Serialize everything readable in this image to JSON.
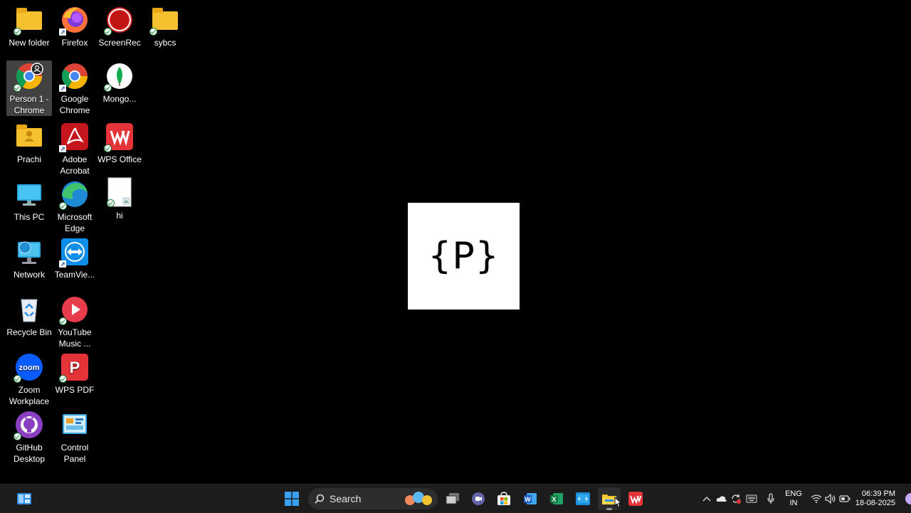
{
  "desktop": {
    "icons": {
      "new_folder": "New folder",
      "firefox": "Firefox",
      "screenrec": "ScreenRec",
      "sybcs": "sybcs",
      "person1_chrome": "Person 1 - Chrome",
      "google_chrome": "Google Chrome",
      "mongo": "Mongo...",
      "prachi": "Prachi",
      "adobe_acrobat": "Adobe Acrobat",
      "wps_office": "WPS Office",
      "this_pc": "This PC",
      "microsoft_edge": "Microsoft Edge",
      "hi": "hi",
      "network": "Network",
      "teamviewer": "TeamVie...",
      "recycle_bin": "Recycle Bin",
      "youtube_music": "YouTube Music ...",
      "zoom_workplace": "Zoom Workplace",
      "wps_pdf": "WPS PDF",
      "github_desktop": "GitHub Desktop",
      "control_panel": "Control Panel"
    },
    "selected_icon": "Person 1 - Chrome"
  },
  "center_logo": {
    "text": "{P}"
  },
  "taskbar": {
    "search_label": "Search",
    "language": {
      "line1": "ENG",
      "line2": "IN"
    },
    "clock": {
      "time": "06:39 PM",
      "date": "18-08-2025"
    }
  },
  "colors": {
    "desktop_bg": "#000000",
    "taskbar_bg": "#1c1c1c",
    "folder_yellow": "#f6c12e"
  }
}
